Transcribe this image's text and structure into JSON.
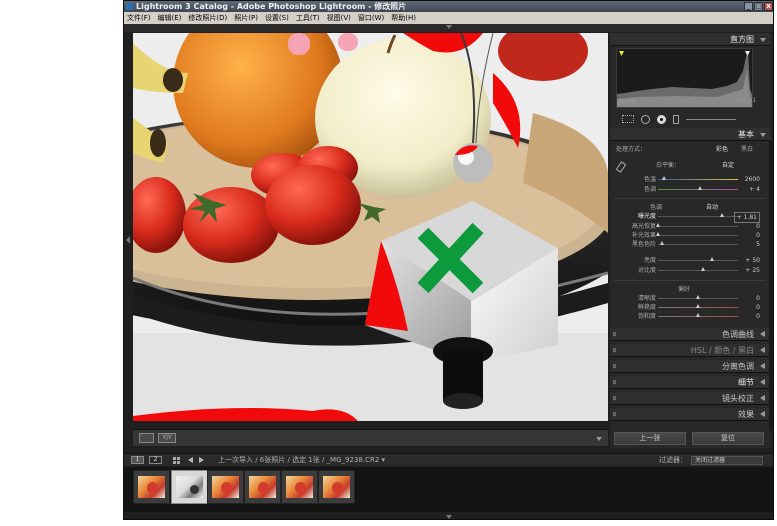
{
  "window": {
    "title": "Lightroom 3 Catalog - Adobe Photoshop Lightroom - 修改照片",
    "minimize": "_",
    "maximize": "□",
    "close": "x"
  },
  "menu": [
    "文件(F)",
    "编辑(E)",
    "修改照片(D)",
    "照片(P)",
    "设置(S)",
    "工具(T)",
    "视图(V)",
    "窗口(W)",
    "帮助(H)"
  ],
  "toolbar": {
    "view_label": "Y|Y"
  },
  "right_panel": {
    "histogram": {
      "title": "直方图",
      "caption": "曝光度",
      "value": "+ 1.81"
    },
    "basic": {
      "title": "基本",
      "treatment_label": "处理方式：",
      "treatment_color": "彩色",
      "treatment_bw": "黑白",
      "wb_label": "白平衡：",
      "wb_value": "自定",
      "temp": {
        "label": "色温",
        "value": "2600",
        "pos": 0.08
      },
      "tint": {
        "label": "色调",
        "value": "+ 4",
        "pos": 0.52
      },
      "tone_label": "色调",
      "auto_label": "自动",
      "exposure": {
        "label": "曝光度",
        "value": "+ 1.81",
        "pos": 0.8
      },
      "recovery": {
        "label": "高光恢复",
        "value": "0",
        "pos": 0.0
      },
      "fill_light": {
        "label": "补光效果",
        "value": "0",
        "pos": 0.0
      },
      "blacks": {
        "label": "黑色色阶",
        "value": "5",
        "pos": 0.05
      },
      "brightness": {
        "label": "亮度",
        "value": "+ 50",
        "pos": 0.68
      },
      "contrast": {
        "label": "对比度",
        "value": "+ 25",
        "pos": 0.56
      },
      "presence_label": "偏好",
      "clarity": {
        "label": "清晰度",
        "value": "0",
        "pos": 0.5
      },
      "vibrance": {
        "label": "鲜艳度",
        "value": "0",
        "pos": 0.5
      },
      "saturation": {
        "label": "饱和度",
        "value": "0",
        "pos": 0.5
      }
    },
    "sections": [
      {
        "label": "色调曲线"
      },
      {
        "label": "HSL / 颜色 / 黑白"
      },
      {
        "label": "分离色调"
      },
      {
        "label": "细节"
      },
      {
        "label": "镜头校正"
      },
      {
        "label": "效果"
      }
    ],
    "prev_button": "上一张",
    "reset_button": "复位"
  },
  "filmstrip": {
    "page1": "1",
    "page2": "2",
    "breadcrumb": "上一次导入 / 6张照片 / 选定 1张 / _MG_9238.CR2 ▾",
    "filter_label": "过滤器：",
    "filter_value": "关闭过滤器",
    "thumb_count": 6,
    "selected_index": 1
  }
}
